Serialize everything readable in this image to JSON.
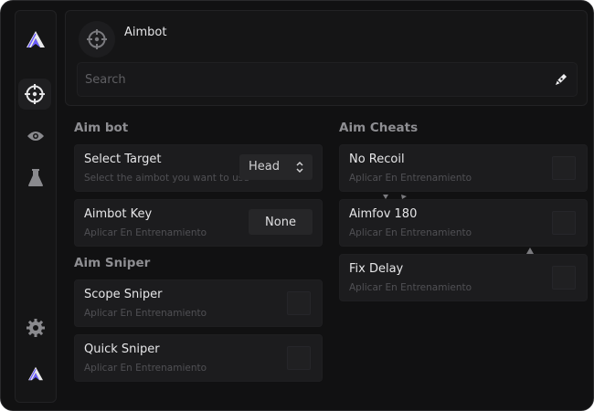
{
  "sidebar": {
    "items": [
      {
        "name": "logo-top",
        "icon": "logo-icon"
      },
      {
        "name": "aim",
        "icon": "crosshair-icon",
        "active": true
      },
      {
        "name": "visuals",
        "icon": "eye-icon"
      },
      {
        "name": "misc",
        "icon": "flask-icon"
      },
      {
        "name": "settings",
        "icon": "gear-icon"
      },
      {
        "name": "logo-bottom",
        "icon": "logo-icon"
      }
    ]
  },
  "header": {
    "title": "Aimbot",
    "icon": "crosshair-icon",
    "search_placeholder": "Search",
    "search_icon": "pen-icon"
  },
  "left_column": {
    "aim_bot_title": "Aim bot",
    "select_target": {
      "title": "Select Target",
      "subtitle": "Select the aimbot you want to use",
      "value": "Head"
    },
    "aimbot_key": {
      "title": "Aimbot Key",
      "subtitle": "Aplicar En Entrenamiento",
      "value": "None"
    },
    "aim_sniper_title": "Aim Sniper",
    "scope_sniper": {
      "title": "Scope Sniper",
      "subtitle": "Aplicar En Entrenamiento"
    },
    "quick_sniper": {
      "title": "Quick Sniper",
      "subtitle": "Aplicar En Entrenamiento"
    }
  },
  "right_column": {
    "aim_cheats_title": "Aim Cheats",
    "no_recoil": {
      "title": "No Recoil",
      "subtitle": "Aplicar En Entrenamiento"
    },
    "aimfov": {
      "title": "Aimfov 180",
      "subtitle": "Aplicar En Entrenamiento"
    },
    "fix_delay": {
      "title": "Fix Delay",
      "subtitle": "Aplicar En Entrenamiento"
    }
  },
  "colors": {
    "background": "#111112",
    "panel": "#151516",
    "card": "#1c1c1e",
    "logo_purple": "#6b5cff",
    "text": "#e6e6e8",
    "muted": "#505054"
  }
}
